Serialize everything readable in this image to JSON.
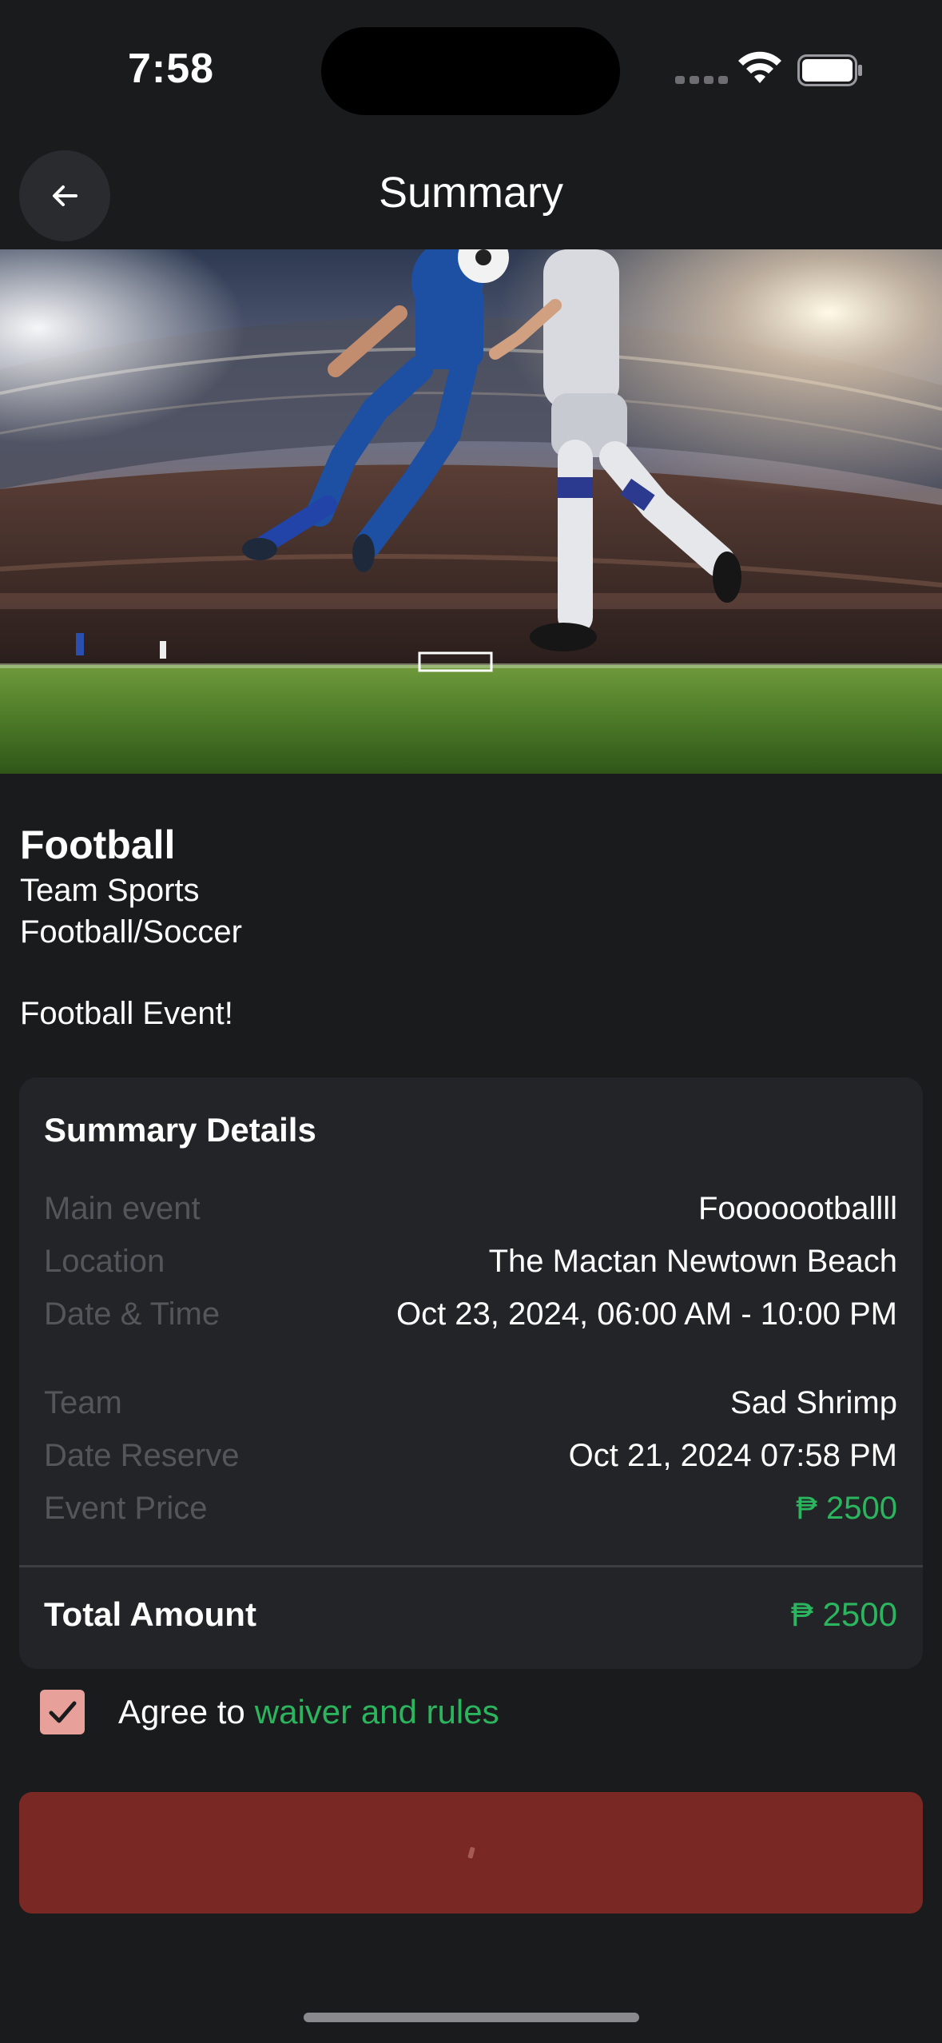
{
  "status_bar": {
    "time": "7:58"
  },
  "header": {
    "title": "Summary"
  },
  "event": {
    "name": "Football",
    "category": "Team Sports",
    "subcategory": "Football/Soccer",
    "description": "Football Event!"
  },
  "summary": {
    "title": "Summary Details",
    "rows": [
      {
        "label": "Main event",
        "value": "Fooooootballll"
      },
      {
        "label": "Location",
        "value": "The Mactan Newtown Beach"
      },
      {
        "label": "Date & Time",
        "value": "Oct 23, 2024, 06:00 AM - 10:00 PM"
      },
      {
        "label": "Team",
        "value": "Sad Shrimp"
      },
      {
        "label": "Date Reserve",
        "value": "Oct 21, 2024 07:58 PM"
      },
      {
        "label": "Event Price",
        "value": "₱ 2500"
      }
    ],
    "total_label": "Total Amount",
    "total_value": "₱ 2500"
  },
  "agreement": {
    "text": "Agree to",
    "link": "waiver and rules",
    "checked": true
  },
  "colors": {
    "background": "#1a1b1d",
    "card": "#232427",
    "accent_green": "#2bb55e",
    "button_red": "#7a2824",
    "checkbox": "#e8a19a"
  },
  "icons": {
    "back": "arrow-left-icon",
    "check": "check-icon",
    "wifi": "wifi-icon",
    "battery": "battery-icon",
    "signal": "signal-icon"
  }
}
